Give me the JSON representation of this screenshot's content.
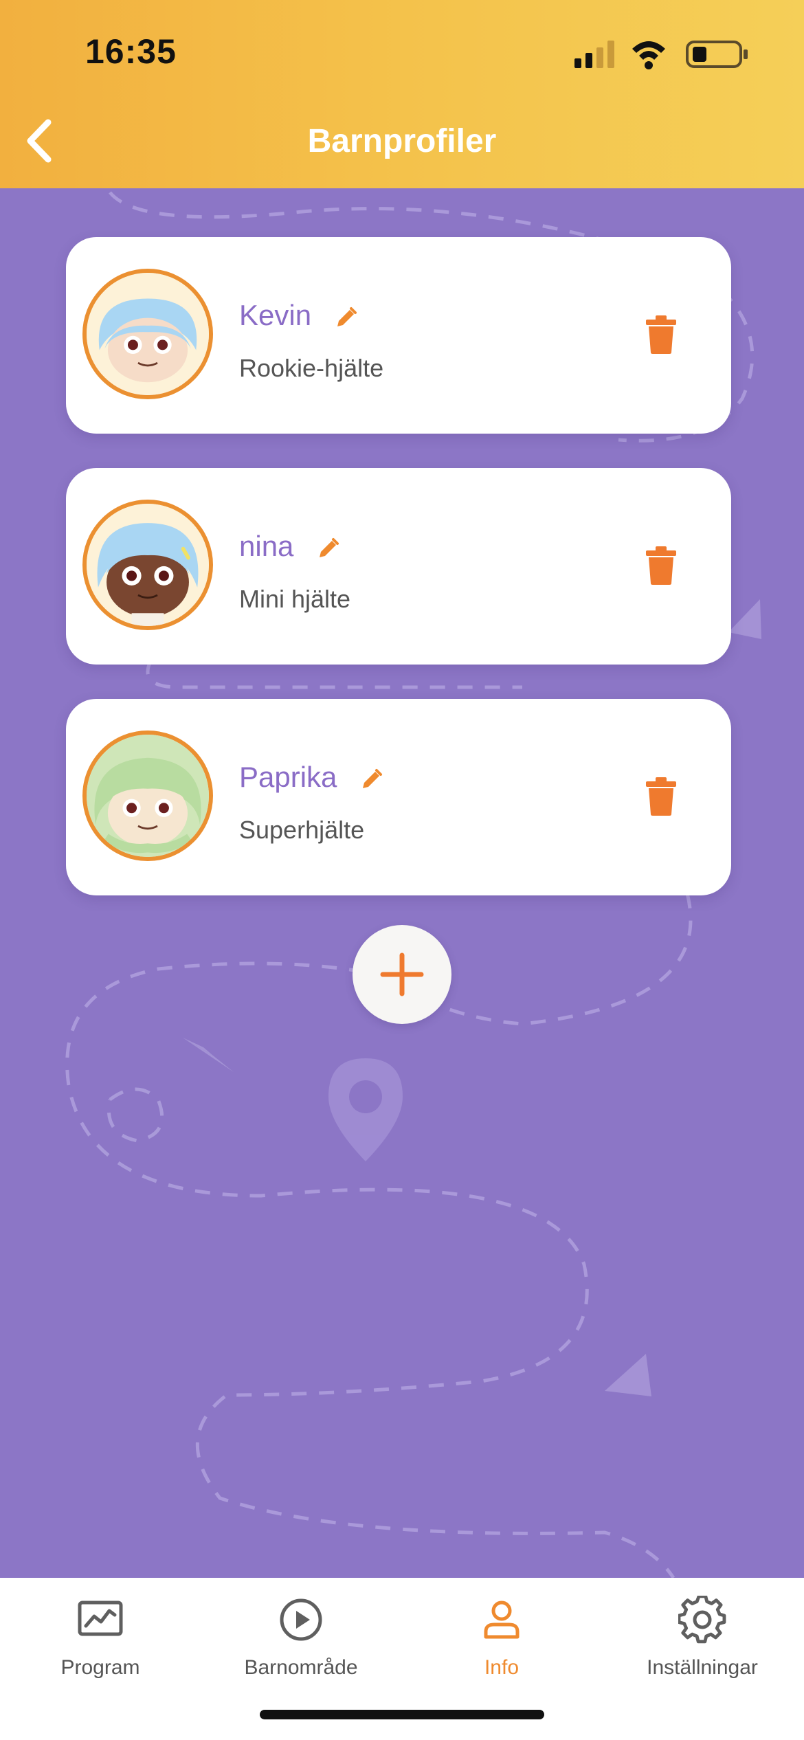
{
  "status_bar": {
    "time": "16:35"
  },
  "header": {
    "title": "Barnprofiler"
  },
  "profiles": [
    {
      "name": "Kevin",
      "level": "Rookie-hjälte"
    },
    {
      "name": "nina",
      "level": "Mini hjälte"
    },
    {
      "name": "Paprika",
      "level": "Superhjälte"
    }
  ],
  "tabs": [
    {
      "label": "Program",
      "icon": "chart-icon"
    },
    {
      "label": "Barnområde",
      "icon": "play-icon"
    },
    {
      "label": "Info",
      "icon": "person-icon",
      "active": true
    },
    {
      "label": "Inställningar",
      "icon": "gear-icon"
    }
  ],
  "colors": {
    "accent": "#ef8a2e",
    "background": "#8c76c6",
    "name_text": "#8a6cc6",
    "header_gradient": [
      "#f2b03f",
      "#f5cf58"
    ]
  }
}
